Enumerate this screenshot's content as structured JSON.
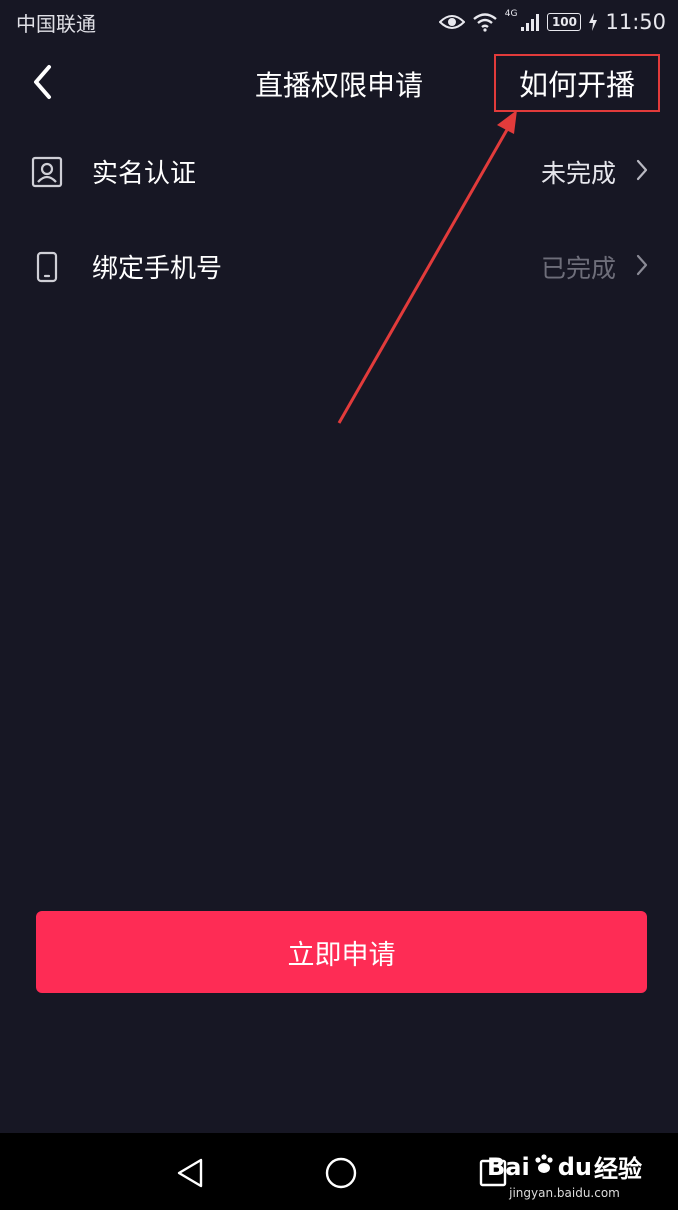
{
  "status_bar": {
    "carrier": "中国联通",
    "network_type": "4G",
    "battery": "100",
    "time": "11:50",
    "icons": [
      "eye-icon",
      "wifi-icon",
      "signal-icon",
      "battery-icon",
      "charging-icon"
    ]
  },
  "nav": {
    "back_icon": "chevron-left-icon",
    "title": "直播权限申请",
    "how_link": "如何开播"
  },
  "requirements": [
    {
      "icon": "id-card-icon",
      "label": "实名认证",
      "status": "未完成",
      "completed": false
    },
    {
      "icon": "phone-icon",
      "label": "绑定手机号",
      "status": "已完成",
      "completed": true
    }
  ],
  "apply_button": "立即申请",
  "system_nav": {
    "icons": [
      "back-triangle-icon",
      "home-circle-icon",
      "recents-square-icon"
    ]
  },
  "watermark": {
    "logo_text": "Bai",
    "logo_suffix": "du",
    "brand_cn": "经验",
    "url": "jingyan.baidu.com"
  },
  "colors": {
    "background": "#171724",
    "accent": "#fe2c55",
    "annotation": "#e23b3b",
    "muted_text": "#6e6e7a"
  }
}
